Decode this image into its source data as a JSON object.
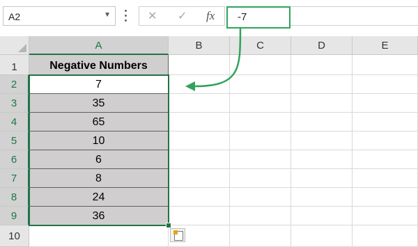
{
  "formula_bar": {
    "name_box": "A2",
    "cancel_icon": "✕",
    "enter_icon": "✓",
    "fx_label": "fx",
    "formula_value": "-7"
  },
  "grid": {
    "columns": [
      "A",
      "B",
      "C",
      "D",
      "E"
    ],
    "rows": [
      "1",
      "2",
      "3",
      "4",
      "5",
      "6",
      "7",
      "8",
      "9",
      "10"
    ],
    "header_cell": "Negative Numbers",
    "values": [
      "7",
      "35",
      "65",
      "10",
      "6",
      "8",
      "24",
      "36"
    ]
  },
  "colors": {
    "accent_green": "#217346",
    "callout_green": "#2fa35a",
    "shaded_cell": "#d0cece"
  }
}
